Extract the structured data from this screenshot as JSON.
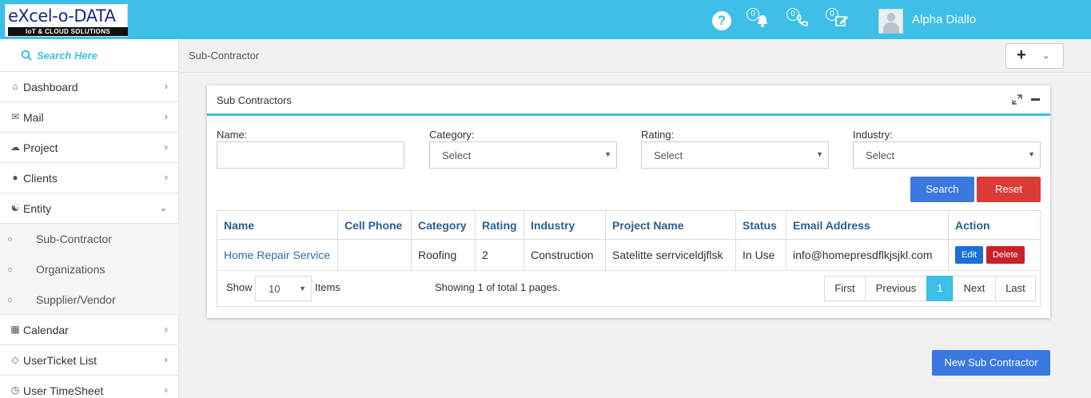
{
  "header": {
    "logo_top": "eXcel-o-DATA",
    "logo_sub": "IoT & CLOUD SOLUTIONS",
    "help_icon": "?",
    "notifications_count": "0",
    "calls_count": "0",
    "tasks_count": "0",
    "username": "Alpha Diallo"
  },
  "sidebar": {
    "search_placeholder": "Search Here",
    "items": [
      {
        "label": "Dashboard",
        "icon": "home-icon"
      },
      {
        "label": "Mail",
        "icon": "envelope-icon"
      },
      {
        "label": "Project",
        "icon": "cloud-icon"
      },
      {
        "label": "Clients",
        "icon": "user-icon"
      },
      {
        "label": "Entity",
        "icon": "users-icon"
      },
      {
        "label": "Calendar",
        "icon": "calendar-icon"
      },
      {
        "label": "UserTicket List",
        "icon": "ticket-icon"
      },
      {
        "label": "User TimeSheet",
        "icon": "clock-icon"
      }
    ],
    "entity_sub": [
      "Sub-Contractor",
      "Organizations",
      "Supplier/Vendor"
    ]
  },
  "breadcrumb": "Sub-Contractor",
  "panel": {
    "title": "Sub Contractors",
    "filters": {
      "name_label": "Name:",
      "name_value": "",
      "category_label": "Category:",
      "category_value": "Select",
      "rating_label": "Rating:",
      "rating_value": "Select",
      "industry_label": "Industry:",
      "industry_value": "Select"
    },
    "search_label": "Search",
    "reset_label": "Reset",
    "table": {
      "headers": [
        "Name",
        "Cell Phone",
        "Category",
        "Rating",
        "Industry",
        "Project Name",
        "Status",
        "Email Address",
        "Action"
      ],
      "rows": [
        {
          "name": "Home Repair Service",
          "cell_phone": "",
          "category": "Roofing",
          "rating": "2",
          "industry": "Construction",
          "project": "Satelitte serrviceldjflsk",
          "status": "In Use",
          "email": "info@homepresdflkjsjkl.com",
          "edit": "Edit",
          "delete": "Delete"
        }
      ]
    },
    "pager": {
      "show": "Show",
      "page_size": "10",
      "items": "Items",
      "showing": "Showing 1 of total 1 pages.",
      "first": "First",
      "previous": "Previous",
      "current": "1",
      "next": "Next",
      "last": "Last"
    }
  },
  "new_button": "New Sub Contractor",
  "colors": {
    "accent": "#3dbfe8",
    "primary": "#3a78e0",
    "danger": "#dc3b35"
  }
}
